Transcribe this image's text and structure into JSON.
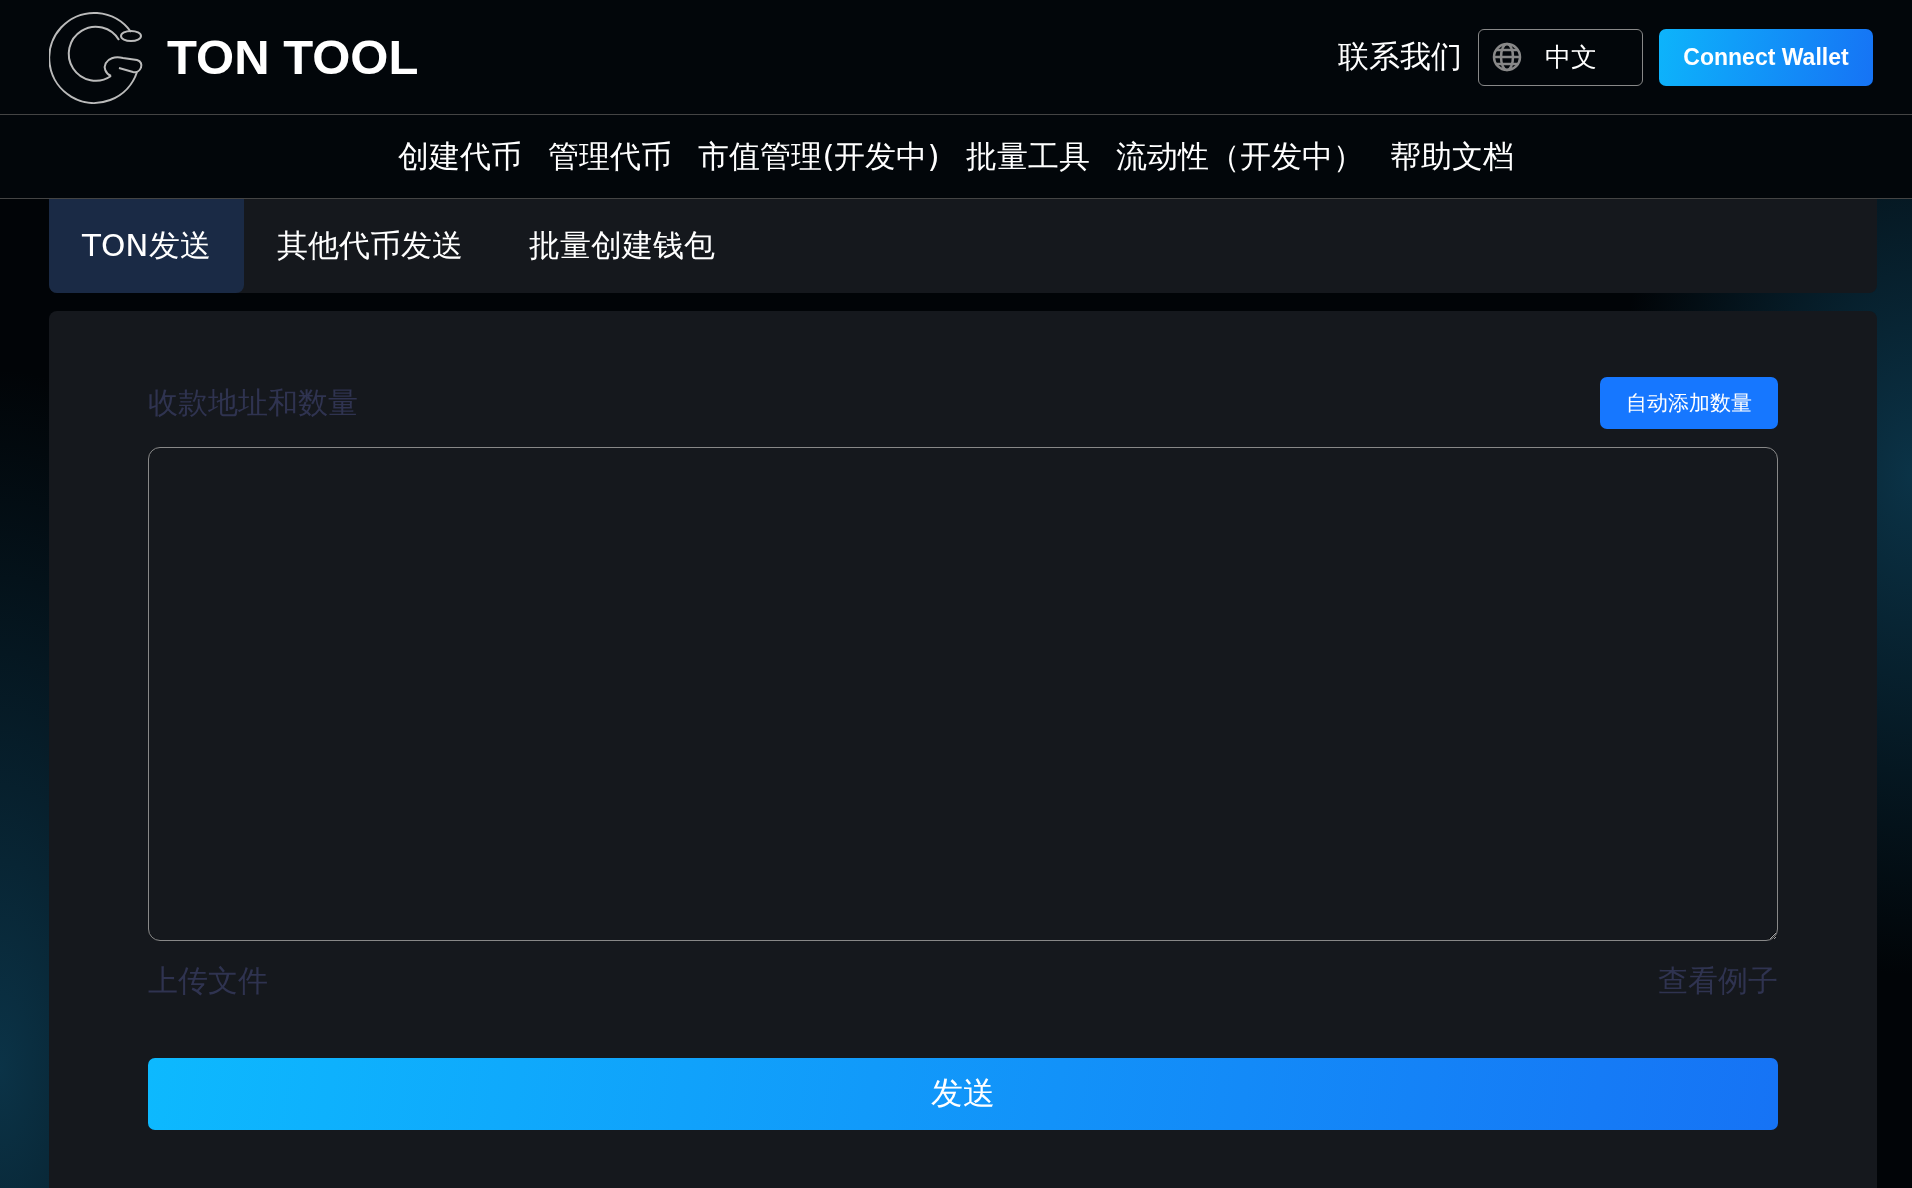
{
  "header": {
    "logo_text": "TON TOOL",
    "contact": "联系我们",
    "language": "中文",
    "connect_button": "Connect Wallet"
  },
  "nav": [
    {
      "label": "创建代币"
    },
    {
      "label": "管理代币"
    },
    {
      "label": "市值管理(开发中)"
    },
    {
      "label": "批量工具"
    },
    {
      "label": "流动性（开发中）"
    },
    {
      "label": "帮助文档"
    }
  ],
  "tabs": [
    {
      "label": "TON发送",
      "selected": true
    },
    {
      "label": "其他代币发送",
      "selected": false
    },
    {
      "label": "批量创建钱包",
      "selected": false
    }
  ],
  "form": {
    "label": "收款地址和数量",
    "auto_add_button": "自动添加数量",
    "upload_link": "上传文件",
    "example_link": "查看例子",
    "send_button": "发送"
  }
}
